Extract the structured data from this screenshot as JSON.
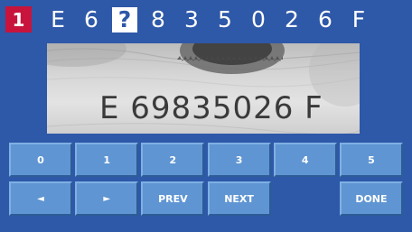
{
  "slot_number": "1",
  "serial": {
    "chars": [
      "E",
      "6",
      "?",
      "8",
      "3",
      "5",
      "0",
      "2",
      "6",
      "F"
    ],
    "current_index": 2
  },
  "note_image": {
    "serial_text": "E 69835026 F"
  },
  "keypad": {
    "row1": [
      "0",
      "1",
      "2",
      "3",
      "4",
      "5"
    ],
    "prev_label": "PREV",
    "next_label": "NEXT",
    "done_label": "DONE",
    "left_arrow": "◄",
    "right_arrow": "►"
  },
  "colors": {
    "background": "#2e58a8",
    "badge": "#c8143c",
    "key_face": "#5f95d2"
  }
}
